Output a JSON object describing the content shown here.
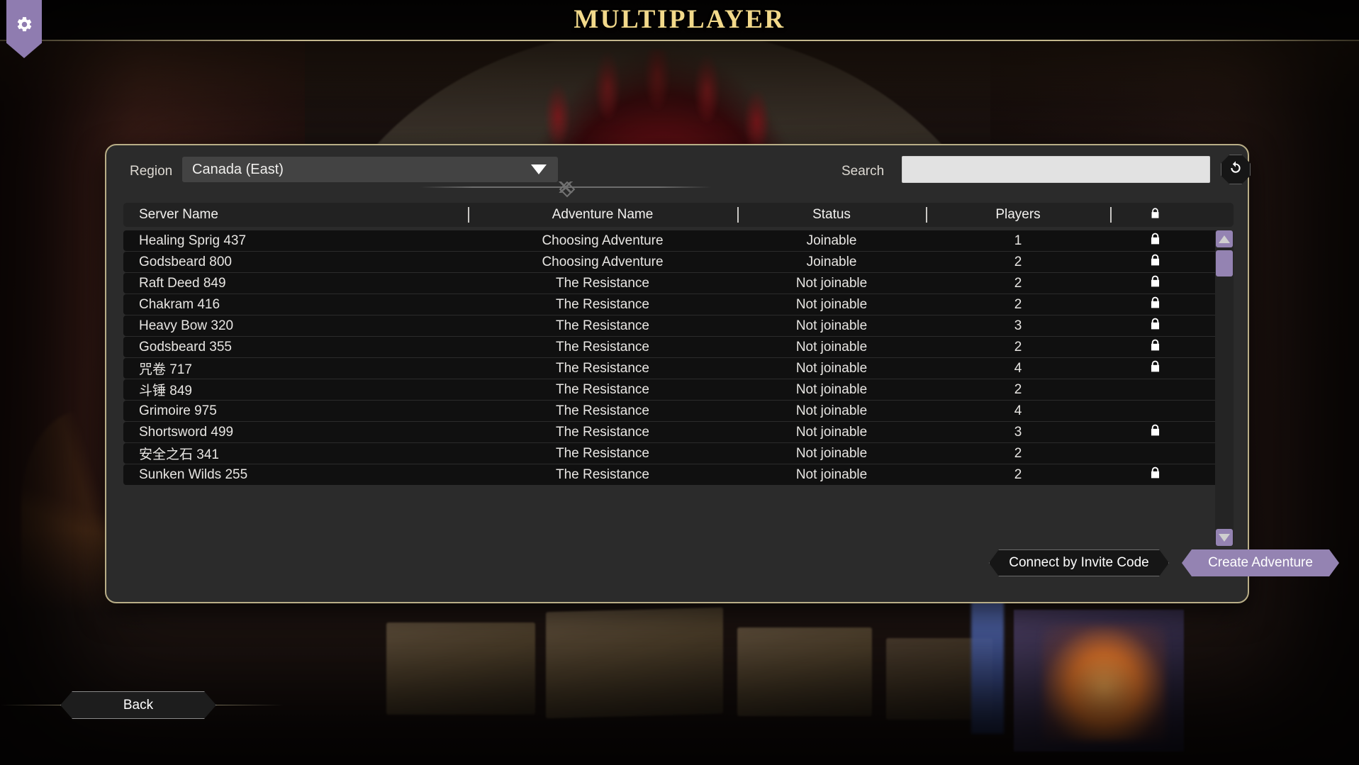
{
  "header": {
    "title": "MULTIPLAYER",
    "settings_icon": "gear-icon"
  },
  "filters": {
    "region_label": "Region",
    "region_value": "Canada (East)",
    "search_label": "Search",
    "search_value": "",
    "search_placeholder": "",
    "refresh_icon": "refresh-icon"
  },
  "table": {
    "columns": {
      "server_name": "Server Name",
      "adventure_name": "Adventure Name",
      "status": "Status",
      "players": "Players",
      "lock": "lock-icon"
    },
    "rows": [
      {
        "server": "Healing Sprig 437",
        "adventure": "Choosing Adventure",
        "status": "Joinable",
        "players": "1",
        "locked": true
      },
      {
        "server": "Godsbeard 800",
        "adventure": "Choosing Adventure",
        "status": "Joinable",
        "players": "2",
        "locked": true
      },
      {
        "server": "Raft Deed 849",
        "adventure": "The Resistance",
        "status": "Not joinable",
        "players": "2",
        "locked": true
      },
      {
        "server": "Chakram 416",
        "adventure": "The Resistance",
        "status": "Not joinable",
        "players": "2",
        "locked": true
      },
      {
        "server": "Heavy Bow 320",
        "adventure": "The Resistance",
        "status": "Not joinable",
        "players": "3",
        "locked": true
      },
      {
        "server": "Godsbeard 355",
        "adventure": "The Resistance",
        "status": "Not joinable",
        "players": "2",
        "locked": true
      },
      {
        "server": "咒卷 717",
        "adventure": "The Resistance",
        "status": "Not joinable",
        "players": "4",
        "locked": true
      },
      {
        "server": "斗锤 849",
        "adventure": "The Resistance",
        "status": "Not joinable",
        "players": "2",
        "locked": false
      },
      {
        "server": "Grimoire 975",
        "adventure": "The Resistance",
        "status": "Not joinable",
        "players": "4",
        "locked": false
      },
      {
        "server": "Shortsword 499",
        "adventure": "The Resistance",
        "status": "Not joinable",
        "players": "3",
        "locked": true
      },
      {
        "server": "安全之石 341",
        "adventure": "The Resistance",
        "status": "Not joinable",
        "players": "2",
        "locked": false
      },
      {
        "server": "Sunken Wilds 255",
        "adventure": "The Resistance",
        "status": "Not joinable",
        "players": "2",
        "locked": true
      }
    ]
  },
  "footer": {
    "invite_label": "Connect by Invite Code",
    "create_label": "Create Adventure",
    "back_label": "Back"
  },
  "colors": {
    "accent_purple": "#9483b2",
    "title_gold": "#f2d98a",
    "panel_border": "#b9ae87",
    "panel_bg": "#2b2b2b"
  }
}
